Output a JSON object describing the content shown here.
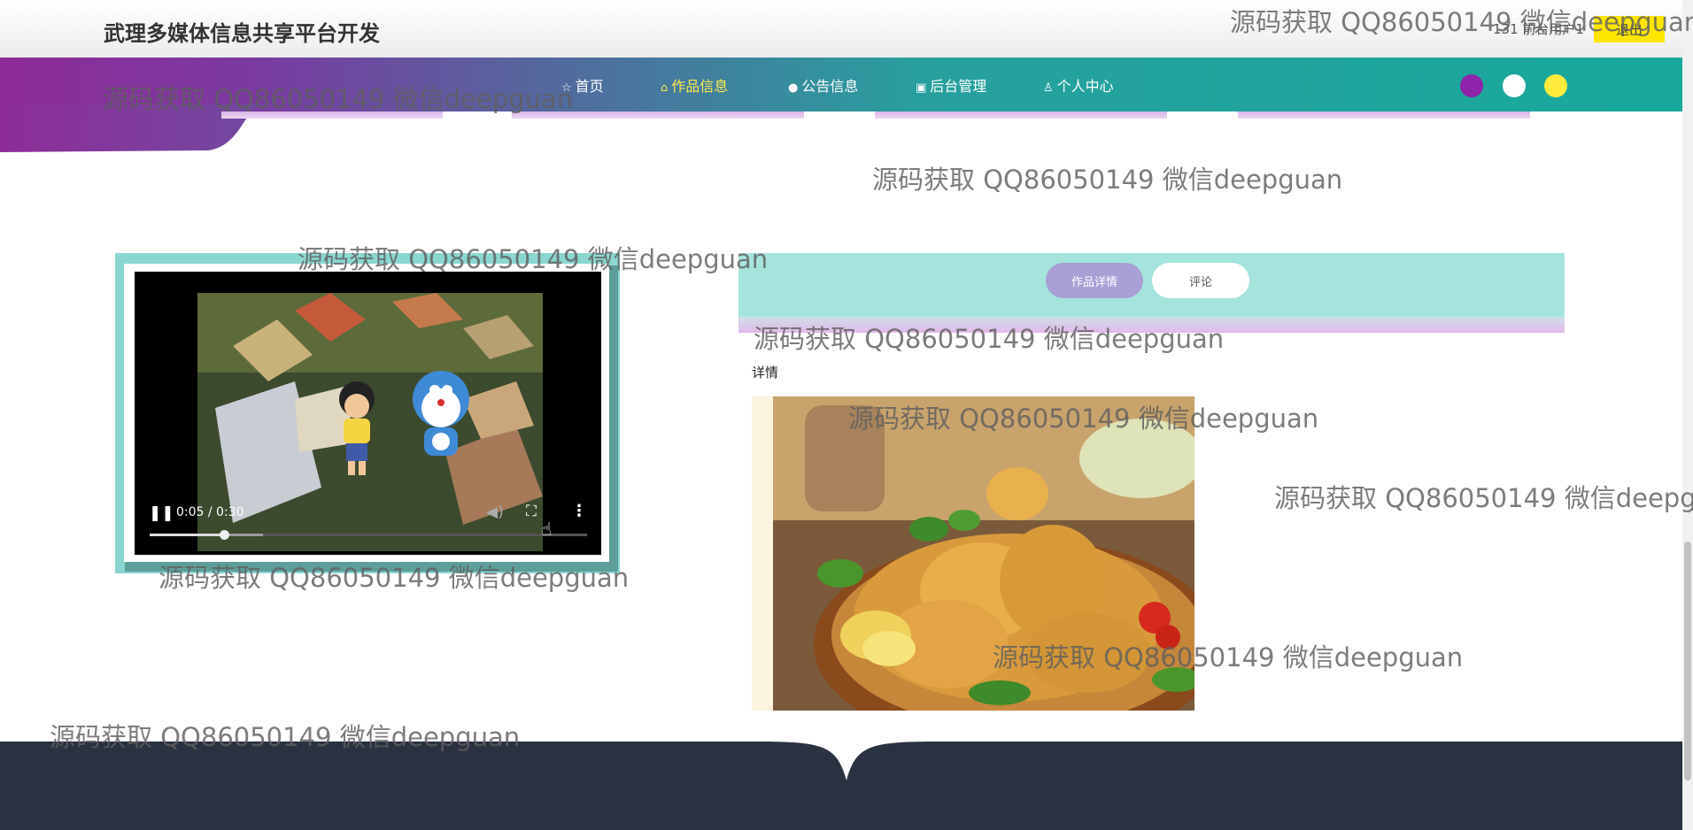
{
  "header": {
    "site_title": "武理多媒体信息共享平台开发",
    "user_info": "131 前台用户1",
    "logout_label": "退出"
  },
  "nav": {
    "items": [
      {
        "icon": "star-icon",
        "label": "首页"
      },
      {
        "icon": "bag-icon",
        "label": "作品信息",
        "active": true
      },
      {
        "icon": "info-icon",
        "label": "公告信息"
      },
      {
        "icon": "cabinet-icon",
        "label": "后台管理"
      },
      {
        "icon": "person-icon",
        "label": "个人中心"
      }
    ],
    "theme_colors": [
      "#8e24aa",
      "#ffffff",
      "#ffeb3b"
    ]
  },
  "video": {
    "time": "0:05 / 0:30",
    "progress": 0.17,
    "buffered": 0.26,
    "paused": false
  },
  "tabs": {
    "detail_label": "作品详情",
    "comment_label": "评论",
    "active": "detail"
  },
  "detail": {
    "label": "详情"
  },
  "watermark": {
    "text": "源码获取 QQ86050149 微信deepguan"
  },
  "colors": {
    "accent_yellow": "#ffe94d",
    "nav_start": "#8e2c98",
    "nav_end": "#18a99c",
    "tab_bg": "#a5e4dc",
    "footer": "#2a3140"
  }
}
